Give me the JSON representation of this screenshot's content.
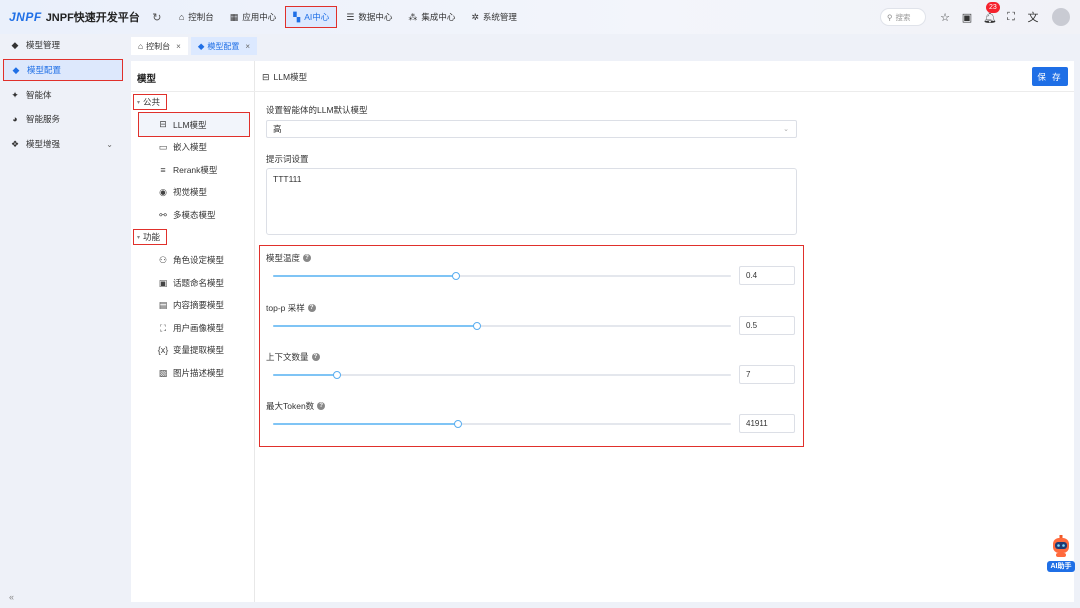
{
  "app": {
    "logo_mark": "JNPF",
    "title": "JNPF快速开发平台"
  },
  "topnav": [
    {
      "label": "控制台",
      "icon": "home-icon",
      "active": false
    },
    {
      "label": "应用中心",
      "icon": "grid-icon",
      "active": false
    },
    {
      "label": "AI中心",
      "icon": "apps-icon",
      "active": true
    },
    {
      "label": "数据中心",
      "icon": "database-icon",
      "active": false
    },
    {
      "label": "集成中心",
      "icon": "integration-icon",
      "active": false
    },
    {
      "label": "系统管理",
      "icon": "gear-icon",
      "active": false
    }
  ],
  "top_right": {
    "search_placeholder": "搜索",
    "notification_count": "23"
  },
  "sidebar": {
    "items": [
      {
        "label": "模型管理",
        "icon": "cube-icon",
        "active": false
      },
      {
        "label": "模型配置",
        "icon": "cube-icon",
        "active": true
      },
      {
        "label": "智能体",
        "icon": "sparkle-icon",
        "active": false
      },
      {
        "label": "智能服务",
        "icon": "robot-icon",
        "active": false
      },
      {
        "label": "模型增强",
        "icon": "cube-stack-icon",
        "active": false
      }
    ]
  },
  "tabs": [
    {
      "label": "控制台",
      "icon": "home-icon",
      "active": false
    },
    {
      "label": "模型配置",
      "icon": "cube-icon",
      "active": true
    }
  ],
  "tree": {
    "title": "模型",
    "groups": [
      {
        "label": "公共",
        "items": [
          {
            "label": "LLM模型",
            "icon": "llm-icon",
            "active": true
          },
          {
            "label": "嵌入模型",
            "icon": "terminal-icon",
            "active": false
          },
          {
            "label": "Rerank模型",
            "icon": "sort-icon",
            "active": false
          },
          {
            "label": "视觉模型",
            "icon": "eye-icon",
            "active": false
          },
          {
            "label": "多模态模型",
            "icon": "nodes-icon",
            "active": false
          }
        ]
      },
      {
        "label": "功能",
        "items": [
          {
            "label": "角色设定模型",
            "icon": "role-icon",
            "active": false
          },
          {
            "label": "话题命名模型",
            "icon": "topic-icon",
            "active": false
          },
          {
            "label": "内容摘要模型",
            "icon": "summary-icon",
            "active": false
          },
          {
            "label": "用户画像模型",
            "icon": "user-scan-icon",
            "active": false
          },
          {
            "label": "变量提取模型",
            "icon": "variable-icon",
            "active": false
          },
          {
            "label": "图片描述模型",
            "icon": "image-icon",
            "active": false
          }
        ]
      }
    ]
  },
  "form": {
    "header_title": "LLM模型",
    "save_label": "保 存",
    "default_model_label": "设置智能体的LLM默认模型",
    "default_model_value": "高",
    "prompt_label": "提示词设置",
    "prompt_value": "TTT111",
    "params": [
      {
        "label": "模型温度",
        "value": "0.4",
        "fill": 0.4
      },
      {
        "label": "top-p 采样",
        "value": "0.5",
        "fill": 0.445
      },
      {
        "label": "上下文数量",
        "value": "7",
        "fill": 0.14
      },
      {
        "label": "最大Token数",
        "value": "41911",
        "fill": 0.405
      }
    ]
  },
  "ai_helper": {
    "label": "AI助手"
  }
}
